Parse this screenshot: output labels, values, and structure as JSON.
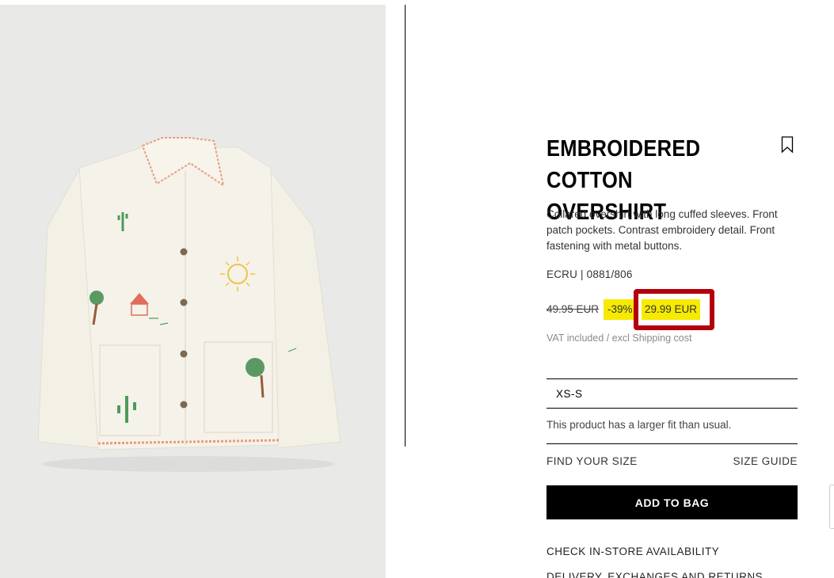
{
  "product": {
    "title": "EMBROIDERED COTTON OVERSHIRT",
    "description": "Collared overshirt with long cuffed sleeves. Front patch pockets. Contrast embroidery detail. Front fastening with metal buttons.",
    "color_ref": "ECRU | 0881/806",
    "price": {
      "original": "49.95 EUR",
      "discount": "-39%",
      "current": "29.99 EUR"
    },
    "vat_note": "VAT included / excl Shipping cost",
    "size": {
      "selected": "XS-S",
      "fit_note": "This product has a larger fit than usual."
    },
    "links": {
      "find_size": "FIND YOUR SIZE",
      "size_guide": "SIZE GUIDE",
      "check_store": "CHECK IN-STORE AVAILABILITY",
      "delivery": "DELIVERY, EXCHANGES AND RETURNS"
    },
    "add_to_bag": "ADD TO BAG"
  },
  "icons": {
    "bookmark": "bookmark-icon"
  },
  "colors": {
    "highlight_yellow": "#f6ea00",
    "annotation_red": "#b3000b",
    "button_black": "#000000"
  }
}
